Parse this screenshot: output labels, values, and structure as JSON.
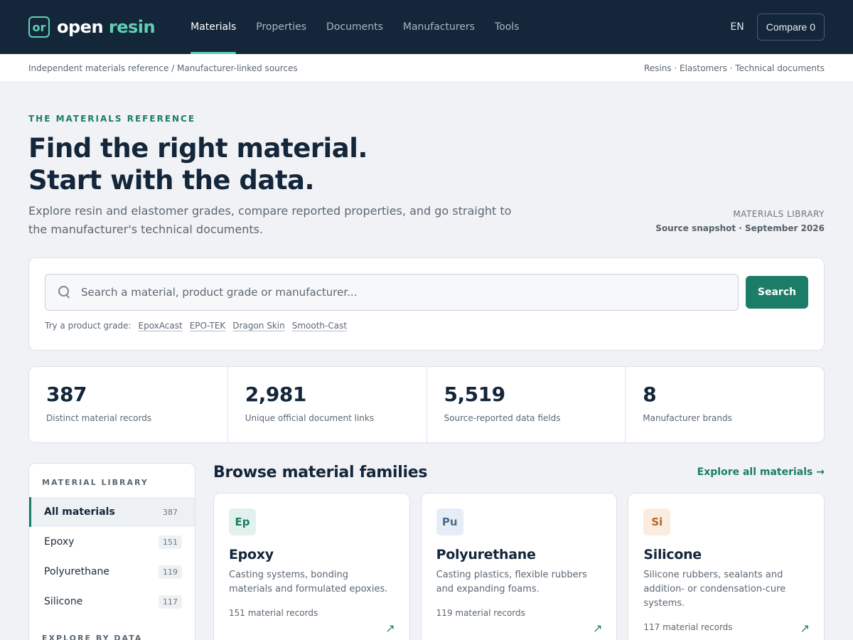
{
  "nav": {
    "logo_mark": "or",
    "logo_word1": "open",
    "logo_word2": "resin",
    "links": [
      {
        "label": "Materials"
      },
      {
        "label": "Properties"
      },
      {
        "label": "Documents"
      },
      {
        "label": "Manufacturers"
      },
      {
        "label": "Tools"
      }
    ],
    "lang": "EN",
    "compare_label": "Compare 0"
  },
  "subbar": {
    "left": "Independent materials reference / Manufacturer-linked sources",
    "right": "Resins · Elastomers · Technical documents"
  },
  "hero": {
    "eyebrow": "THE MATERIALS REFERENCE",
    "title_line1": "Find the right material.",
    "title_line2": "Start with the data.",
    "description": "Explore resin and elastomer grades, compare reported properties, and go straight to the manufacturer's technical documents.",
    "snapshot_label": "MATERIALS LIBRARY",
    "snapshot_value": "Source snapshot · September 2026"
  },
  "search": {
    "placeholder": "Search a material, product grade or manufacturer...",
    "button_label": "Search",
    "suggest_prefix": "Try a product grade:",
    "suggestions": [
      "EpoxAcast",
      "EPO-TEK",
      "Dragon Skin",
      "Smooth-Cast"
    ]
  },
  "stats": [
    {
      "value": "387",
      "label": "Distinct material records"
    },
    {
      "value": "2,981",
      "label": "Unique official document links"
    },
    {
      "value": "5,519",
      "label": "Source-reported data fields"
    },
    {
      "value": "8",
      "label": "Manufacturer brands"
    }
  ],
  "sidebar": {
    "heading": "MATERIAL LIBRARY",
    "items": [
      {
        "label": "All materials",
        "count": "387"
      },
      {
        "label": "Epoxy",
        "count": "151"
      },
      {
        "label": "Polyurethane",
        "count": "119"
      },
      {
        "label": "Silicone",
        "count": "117"
      }
    ],
    "heading2": "EXPLORE BY DATA"
  },
  "families": {
    "title": "Browse material families",
    "explore_label": "Explore all materials →",
    "cards": [
      {
        "badge": "Ep",
        "title": "Epoxy",
        "desc": "Casting systems, bonding materials and formulated epoxies.",
        "count": "151 material records",
        "badge_bg": "#e3f1ec",
        "badge_fg": "#1b7d68"
      },
      {
        "badge": "Pu",
        "title": "Polyurethane",
        "desc": "Casting plastics, flexible rubbers and expanding foams.",
        "count": "119 material records",
        "badge_bg": "#e6edf6",
        "badge_fg": "#4d6a8c"
      },
      {
        "badge": "Si",
        "title": "Silicone",
        "desc": "Silicone rubbers, sealants and addition- or condensation-cure systems.",
        "count": "117 material records",
        "badge_bg": "#fbece0",
        "badge_fg": "#b3652a"
      }
    ],
    "arrow": "↗"
  }
}
